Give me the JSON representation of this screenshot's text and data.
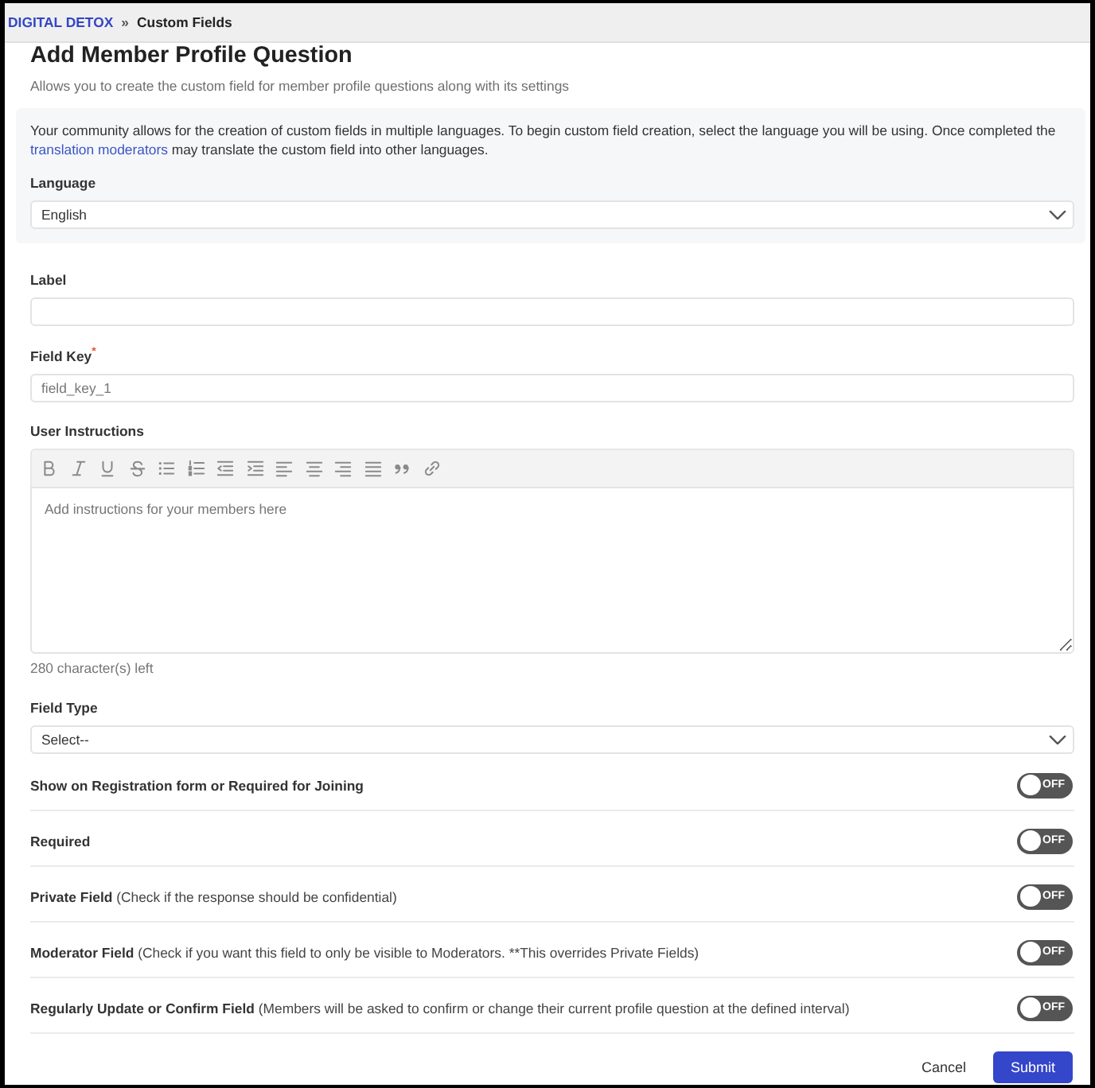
{
  "breadcrumb": {
    "items": [
      {
        "text": "DIGITAL DETOX",
        "kind": "link"
      },
      {
        "text": "Custom Fields",
        "kind": "current"
      }
    ],
    "separator": "»"
  },
  "header": {
    "title": "Add Member Profile Question",
    "subtitle": "Allows you to create the custom field for member profile questions along with its settings"
  },
  "language_panel": {
    "text": "Your community allows for the creation of custom fields in multiple languages. To begin custom field creation, select the language you will be using. Once completed the",
    "link": "translation moderators",
    "text_after": "may translate the custom field into other languages.",
    "field": {
      "kind": "select",
      "label": "Language",
      "value": "English"
    }
  },
  "fields": [
    {
      "kind": "text",
      "label": "Label"
    },
    {
      "kind": "text",
      "label": "Field Key$^{*}$",
      "placeholder": "field_key_1"
    },
    {
      "kind": "editor",
      "label": "User Instructions",
      "toolbar": [
        {
          "kind": "bold"
        },
        {
          "kind": "italic"
        },
        {
          "kind": "underline"
        },
        {
          "kind": "strikethrough"
        },
        {
          "kind": "bullet-list"
        },
        {
          "kind": "numbered-list"
        },
        {
          "kind": "outdent"
        },
        {
          "kind": "indent"
        },
        {
          "kind": "align-left"
        },
        {
          "kind": "align-center"
        },
        {
          "kind": "align-right"
        },
        {
          "kind": "justify"
        },
        {
          "kind": "quote"
        },
        {
          "kind": "link"
        }
      ],
      "placeholder": "Add instructions for your members here",
      "counter": "280 character(s) left"
    },
    {
      "kind": "select",
      "label": "Field Type",
      "value": "Select--"
    }
  ],
  "toggles": [
    {
      "label": "Show on Registration form or Required for Joining",
      "on": false,
      "switch_text": "OFF"
    },
    {
      "label": "Required",
      "on": false,
      "switch_text": "OFF"
    },
    {
      "label": "Private Field",
      "hint": "(Check if the response should be confidential)",
      "on": false,
      "switch_text": "OFF"
    },
    {
      "label": "Moderator Field",
      "hint": "(Check if you want this field to only be visible to Moderators. **This overrides Private Fields)",
      "on": false,
      "switch_text": "OFF"
    },
    {
      "label": "Regularly Update or Confirm Field",
      "hint": "(Members will be asked to confirm or change their current profile question at the defined interval)",
      "on": false,
      "switch_text": "OFF"
    }
  ],
  "buttons": [
    {
      "label": "Cancel",
      "kind": "secondary"
    },
    {
      "label": "Submit",
      "kind": "primary"
    }
  ]
}
